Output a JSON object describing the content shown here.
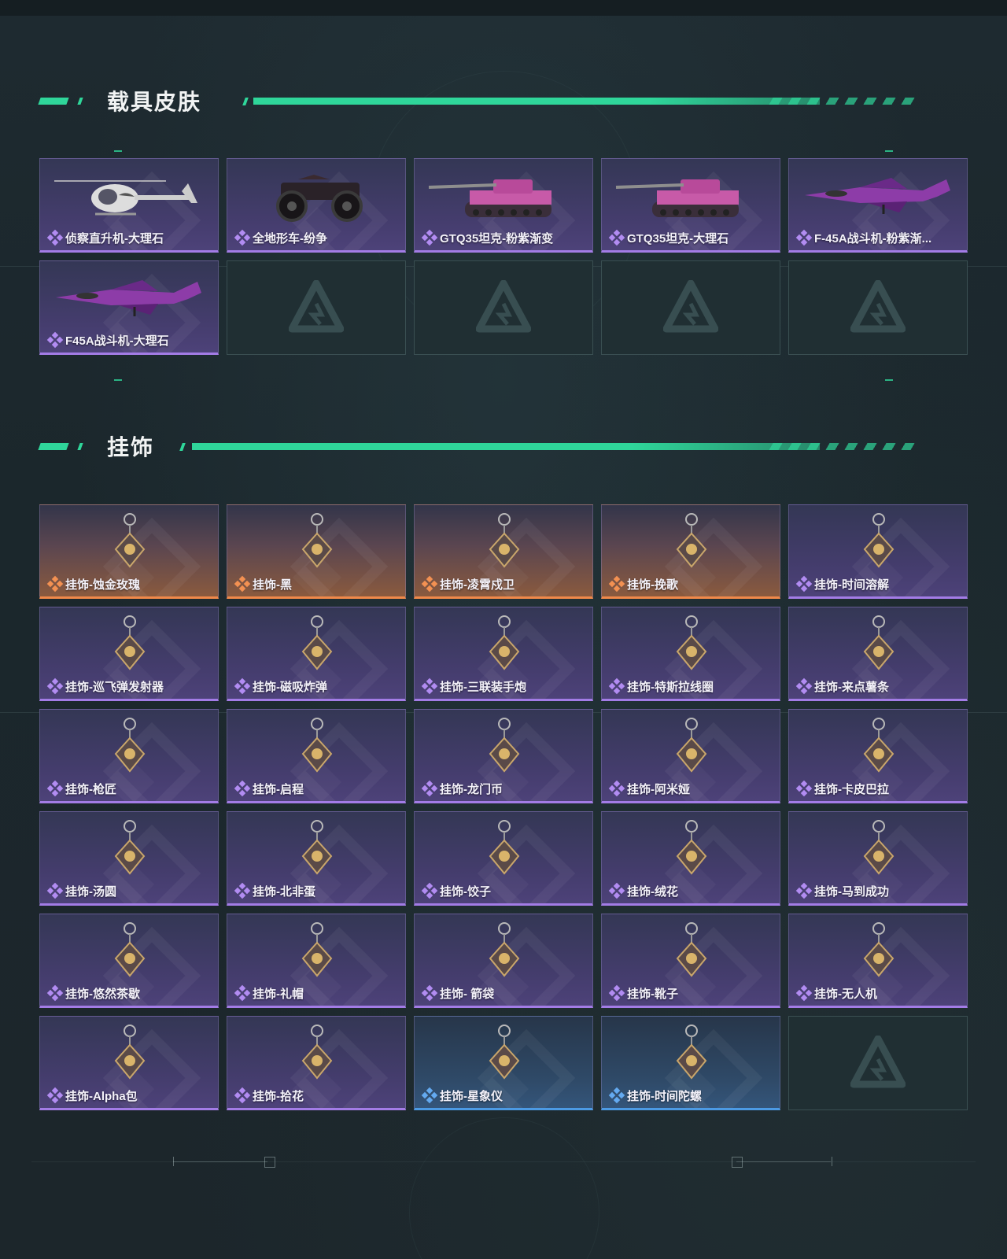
{
  "colors": {
    "accent": "#2fd69a",
    "rarity_purple": "#a37ce6",
    "rarity_orange": "#f0894a",
    "rarity_blue": "#4c9ae4"
  },
  "sections": {
    "vehicle": {
      "title": "载具皮肤",
      "items": [
        {
          "label": "侦察直升机-大理石",
          "rarity": "purple",
          "icon": "helicopter-icon"
        },
        {
          "label": "全地形车-纷争",
          "rarity": "purple",
          "icon": "atv-icon"
        },
        {
          "label": "GTQ35坦克-粉紫渐变",
          "rarity": "purple",
          "icon": "tank-icon"
        },
        {
          "label": "GTQ35坦克-大理石",
          "rarity": "purple",
          "icon": "tank-icon"
        },
        {
          "label": "F-45A战斗机-粉紫渐...",
          "rarity": "purple",
          "icon": "jet-icon"
        },
        {
          "label": "F45A战斗机-大理石",
          "rarity": "purple",
          "icon": "jet-icon"
        }
      ]
    },
    "charm": {
      "title": "挂饰",
      "items": [
        {
          "label": "挂饰-蚀金玫瑰",
          "rarity": "orange",
          "icon": "charm-icon"
        },
        {
          "label": "挂饰-黑",
          "rarity": "orange",
          "icon": "charm-icon"
        },
        {
          "label": "挂饰-凌霄戍卫",
          "rarity": "orange",
          "icon": "charm-icon"
        },
        {
          "label": "挂饰-挽歌",
          "rarity": "orange",
          "icon": "charm-icon"
        },
        {
          "label": "挂饰-时间溶解",
          "rarity": "purple",
          "icon": "charm-icon"
        },
        {
          "label": "挂饰-巡飞弹发射器",
          "rarity": "purple",
          "icon": "charm-icon"
        },
        {
          "label": "挂饰-磁吸炸弹",
          "rarity": "purple",
          "icon": "charm-icon"
        },
        {
          "label": "挂饰-三联装手炮",
          "rarity": "purple",
          "icon": "charm-icon"
        },
        {
          "label": "挂饰-特斯拉线圈",
          "rarity": "purple",
          "icon": "charm-icon"
        },
        {
          "label": "挂饰-来点薯条",
          "rarity": "purple",
          "icon": "charm-icon"
        },
        {
          "label": "挂饰-枪匠",
          "rarity": "purple",
          "icon": "charm-icon"
        },
        {
          "label": "挂饰-启程",
          "rarity": "purple",
          "icon": "charm-icon"
        },
        {
          "label": "挂饰-龙门币",
          "rarity": "purple",
          "icon": "charm-icon"
        },
        {
          "label": "挂饰-阿米娅",
          "rarity": "purple",
          "icon": "charm-icon"
        },
        {
          "label": "挂饰-卡皮巴拉",
          "rarity": "purple",
          "icon": "charm-icon"
        },
        {
          "label": "挂饰-汤圆",
          "rarity": "purple",
          "icon": "charm-icon"
        },
        {
          "label": "挂饰-北非蛋",
          "rarity": "purple",
          "icon": "charm-icon"
        },
        {
          "label": "挂饰-饺子",
          "rarity": "purple",
          "icon": "charm-icon"
        },
        {
          "label": "挂饰-绒花",
          "rarity": "purple",
          "icon": "charm-icon"
        },
        {
          "label": "挂饰-马到成功",
          "rarity": "purple",
          "icon": "charm-icon"
        },
        {
          "label": "挂饰-悠然茶歇",
          "rarity": "purple",
          "icon": "charm-icon"
        },
        {
          "label": "挂饰-礼帽",
          "rarity": "purple",
          "icon": "charm-icon"
        },
        {
          "label": "挂饰- 箭袋",
          "rarity": "purple",
          "icon": "charm-icon"
        },
        {
          "label": "挂饰-靴子",
          "rarity": "purple",
          "icon": "charm-icon"
        },
        {
          "label": "挂饰-无人机",
          "rarity": "purple",
          "icon": "charm-icon"
        },
        {
          "label": "挂饰-Alpha包",
          "rarity": "purple",
          "icon": "charm-icon"
        },
        {
          "label": "挂饰-拾花",
          "rarity": "purple",
          "icon": "charm-icon"
        },
        {
          "label": "挂饰-星象仪",
          "rarity": "blue",
          "icon": "charm-icon"
        },
        {
          "label": "挂饰-时间陀螺",
          "rarity": "blue",
          "icon": "charm-icon"
        }
      ]
    }
  }
}
